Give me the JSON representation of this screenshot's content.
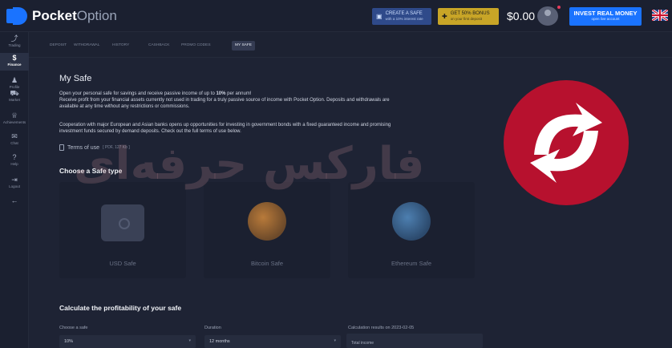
{
  "brand": {
    "bold": "Pocket",
    "light": "Option"
  },
  "topbar": {
    "create_safe": {
      "title": "CREATE A SAFE",
      "sub": "with a 10% interest rate"
    },
    "bonus": {
      "title": "GET 50% BONUS",
      "sub": "on your first deposit"
    },
    "balance": "$0.00",
    "invest": {
      "title": "INVEST REAL MONEY",
      "sub": "open live account"
    }
  },
  "sidebar": {
    "items": [
      {
        "icon": "chart-icon",
        "glyph": "⤴",
        "label": "Trading",
        "active": false
      },
      {
        "icon": "dollar-icon",
        "glyph": "$",
        "label": "Finance",
        "active": true
      },
      {
        "icon": "person-icon",
        "glyph": "♟",
        "label": "Profile",
        "active": false
      },
      {
        "icon": "cart-icon",
        "glyph": "⛟",
        "label": "Market",
        "active": false
      },
      {
        "icon": "trophy-icon",
        "glyph": "♕",
        "label": "Achievements",
        "active": false,
        "badge": ""
      },
      {
        "icon": "chat-icon",
        "glyph": "✉",
        "label": "Chat",
        "active": false,
        "badge": ""
      },
      {
        "icon": "help-icon",
        "glyph": "?",
        "label": "Help",
        "active": false,
        "badge": ""
      },
      {
        "icon": "logout-icon",
        "glyph": "⇥",
        "label": "Logout",
        "active": false
      },
      {
        "icon": "arrow-left-icon",
        "glyph": "←",
        "label": "",
        "active": false
      }
    ]
  },
  "tabs": [
    "DEPOSIT",
    "WITHDRAWAL",
    "HISTORY",
    "CASHBACK",
    "PROMO CODES",
    "MY SAFE"
  ],
  "active_tab": "MY SAFE",
  "page": {
    "title": "My Safe",
    "line1_pre": "Open your personal safe for savings and receive passive income of up to ",
    "line1_bold": "10%",
    "line1_post": " per annum!",
    "line2": "Receive profit from your financial assets currently not used in trading for a truly passive source of income with Pocket Option. Deposits and withdrawals are",
    "line3": "available at any time without any restrictions or commissions.",
    "line4": "Cooperation with major European and Asian banks opens up opportunities for investing in government bonds with a fixed guaranteed income and promising",
    "line5": "investment funds secured by demand deposits. Check out the full terms of use below.",
    "terms_label": "Terms of use",
    "terms_size": "[ PDF, 127 Kb ]",
    "choose_title": "Choose a Safe type",
    "cards": [
      {
        "label": "USD Safe"
      },
      {
        "label": "Bitcoin Safe"
      },
      {
        "label": "Ethereum Safe"
      }
    ],
    "calc_title": "Calculate the profitability of your safe",
    "choose_safe_label": "Choose a safe",
    "choose_safe_value": "10%",
    "duration_label": "Duration",
    "duration_value": "12 months",
    "results_label": "Calculation results on 2023-02-05",
    "total_income_label": "Total income"
  },
  "watermark": {
    "text": "فارکس حرفه‌ای"
  },
  "colors": {
    "accent": "#1a73ff",
    "bonus": "#c8a527",
    "badge": "#e0314b",
    "watermark": "#c8102e"
  }
}
